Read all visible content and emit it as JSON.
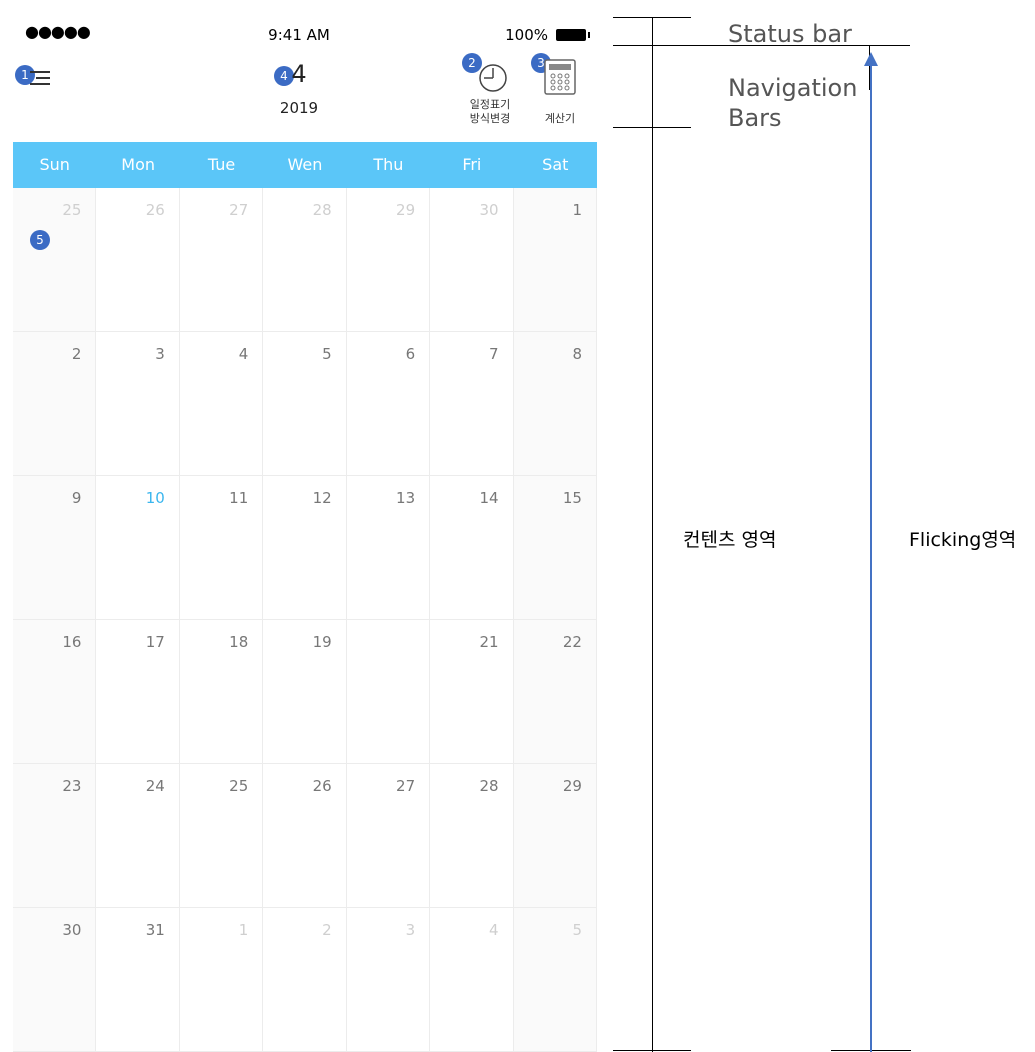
{
  "status_bar": {
    "signal": "●●●●●",
    "time": "9:41 AM",
    "battery": "100%"
  },
  "nav": {
    "month": "4",
    "year": "2019",
    "schedule_label": "일정표기\n방식변경",
    "calculator_label": "계산기",
    "badges": [
      "1",
      "2",
      "3",
      "4",
      "5"
    ]
  },
  "weekdays": [
    "Sun",
    "Mon",
    "Tue",
    "Wen",
    "Thu",
    "Fri",
    "Sat"
  ],
  "weeks": [
    [
      {
        "d": "25",
        "dim": true
      },
      {
        "d": "26",
        "dim": true
      },
      {
        "d": "27",
        "dim": true
      },
      {
        "d": "28",
        "dim": true
      },
      {
        "d": "29",
        "dim": true
      },
      {
        "d": "30",
        "dim": true
      },
      {
        "d": "1"
      }
    ],
    [
      {
        "d": "2"
      },
      {
        "d": "3"
      },
      {
        "d": "4"
      },
      {
        "d": "5"
      },
      {
        "d": "6"
      },
      {
        "d": "7"
      },
      {
        "d": "8"
      }
    ],
    [
      {
        "d": "9"
      },
      {
        "d": "10",
        "today": true
      },
      {
        "d": "11"
      },
      {
        "d": "12"
      },
      {
        "d": "13"
      },
      {
        "d": "14"
      },
      {
        "d": "15"
      }
    ],
    [
      {
        "d": "16"
      },
      {
        "d": "17"
      },
      {
        "d": "18"
      },
      {
        "d": "19"
      },
      {
        "d": ""
      },
      {
        "d": "21"
      },
      {
        "d": "22"
      }
    ],
    [
      {
        "d": "23"
      },
      {
        "d": "24"
      },
      {
        "d": "25"
      },
      {
        "d": "26"
      },
      {
        "d": "27"
      },
      {
        "d": "28"
      },
      {
        "d": "29"
      }
    ],
    [
      {
        "d": "30"
      },
      {
        "d": "31"
      },
      {
        "d": "1",
        "dim": true
      },
      {
        "d": "2",
        "dim": true
      },
      {
        "d": "3",
        "dim": true
      },
      {
        "d": "4",
        "dim": true
      },
      {
        "d": "5",
        "dim": true
      }
    ]
  ],
  "annotations": {
    "status_bar": "Status bar",
    "navigation": "Navigation\nBars",
    "content": "컨텐츠 영역",
    "flicking": "Flicking영역"
  },
  "colors": {
    "accent": "#5bc6f8",
    "today": "#3bb6ee",
    "badge": "#3b6bc4",
    "arrow": "#4472c4"
  }
}
